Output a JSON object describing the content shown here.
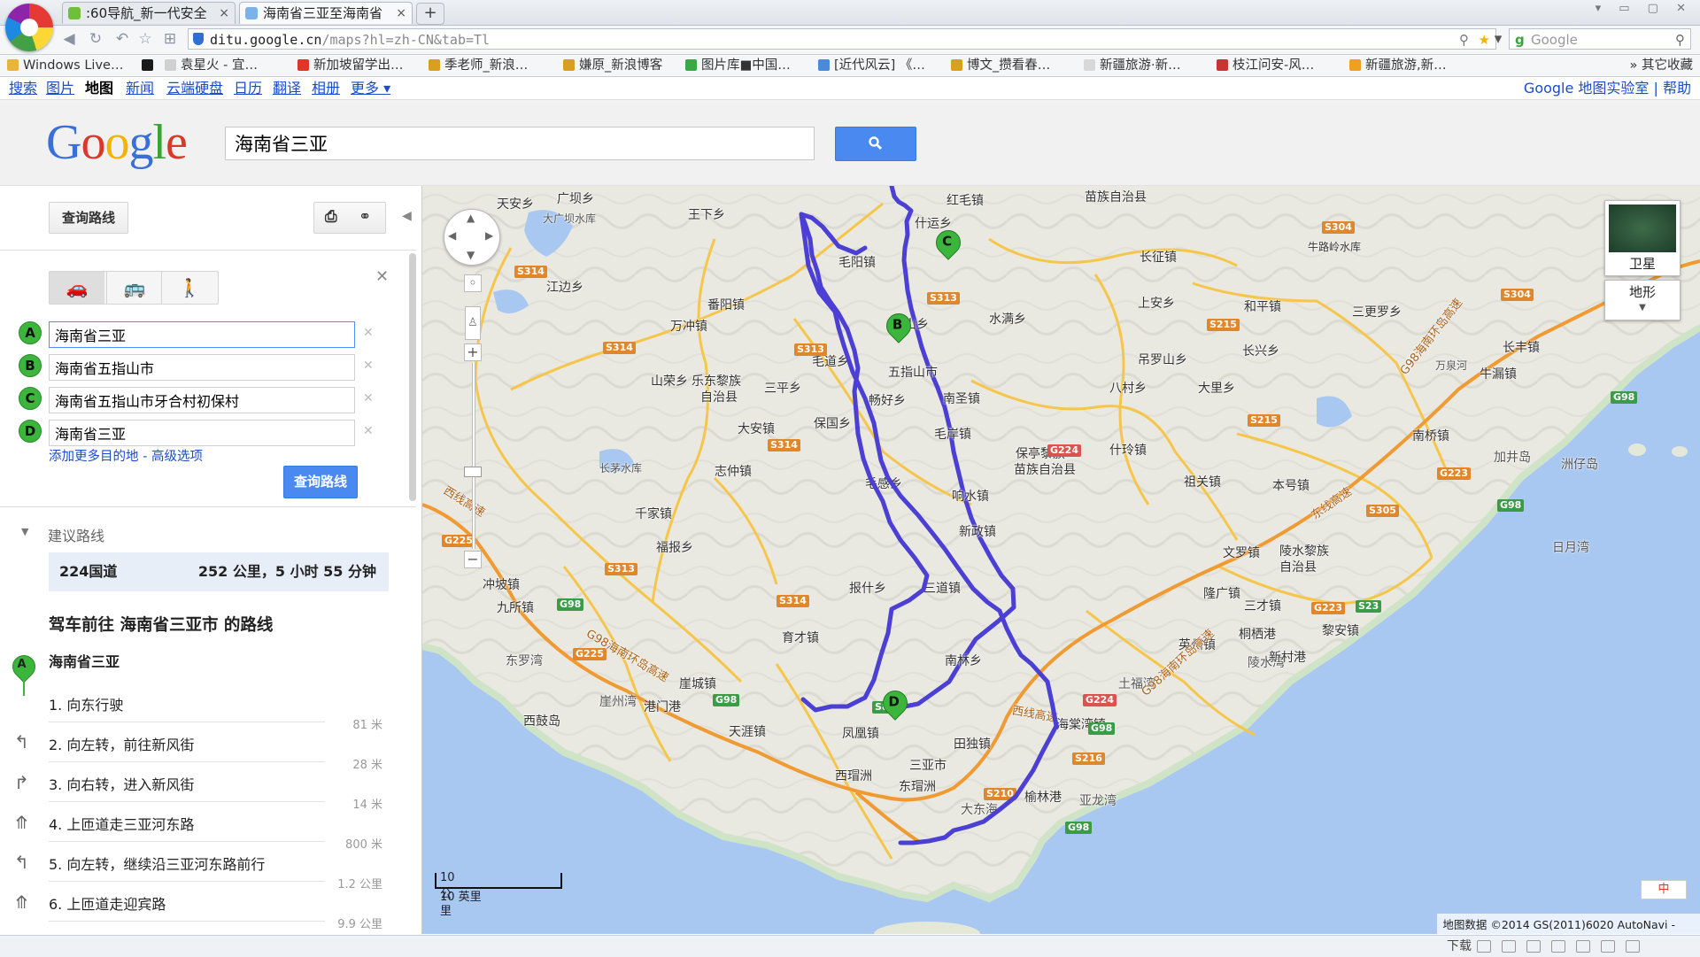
{
  "browser": {
    "tabs": [
      {
        "title": ":60导航_新一代安全",
        "active": false
      },
      {
        "title": "海南省三亚至海南省",
        "active": true
      }
    ],
    "new_tab": "+",
    "url_host": "ditu.google.cn",
    "url_path": "/maps?hl=zh-CN&tab=Tl",
    "search_placeholder": "Google",
    "status_download": "下载"
  },
  "bookmarks": [
    {
      "label": "Windows Live…",
      "color": "#f0c24a"
    },
    {
      "label": "",
      "color": "#1a1a1a"
    },
    {
      "label": "袁星火 - 宜…",
      "color": "#e0e0e0"
    },
    {
      "label": "新加坡留学出…",
      "color": "#e0352b"
    },
    {
      "label": "季老师_新浪…",
      "color": "#d9a020"
    },
    {
      "label": "嫌原_新浪博客",
      "color": "#d9a020"
    },
    {
      "label": "图片库■中国…",
      "color": "#39a845"
    },
    {
      "label": "[近代风云] 《…",
      "color": "#4a8ad8"
    },
    {
      "label": "博文_攒看春…",
      "color": "#d9a020"
    },
    {
      "label": "新疆旅游·新…",
      "color": "#e0e0e0"
    },
    {
      "label": "枝江问安-风…",
      "color": "#cc3333"
    },
    {
      "label": "新疆旅游,新…",
      "color": "#f0a020"
    }
  ],
  "bookmarks_more": "其它收藏",
  "gbar": {
    "links": [
      "搜索",
      "图片",
      "地图",
      "新闻",
      "云端硬盘",
      "日历",
      "翻译",
      "相册",
      "更多 ▾"
    ],
    "active": "地图",
    "right": "Google 地图实验室 | 帮助"
  },
  "search": {
    "logo": "Google",
    "query": "海南省三亚"
  },
  "panel": {
    "get_directions": "查询路线",
    "destinations": [
      {
        "letter": "A",
        "value": "海南省三亚"
      },
      {
        "letter": "B",
        "value": "海南省五指山市"
      },
      {
        "letter": "C",
        "value": "海南省五指山市牙合村初保村"
      },
      {
        "letter": "D",
        "value": "海南省三亚"
      }
    ],
    "add_more": "添加更多目的地 - 高级选项",
    "route_button": "查询路线",
    "suggested_title": "建议路线",
    "suggested_road": "224国道",
    "suggested_distance": "252 公里，5 小时 55 分钟",
    "directions_heading": "驾车前往 海南省三亚市 的路线",
    "start_name": "海南省三亚",
    "start_letter": "A",
    "steps": [
      {
        "text": "1. 向东行驶",
        "distance": "81 米",
        "icon": "straight-icon"
      },
      {
        "text": "2. 向左转，前往新风街",
        "distance": "28 米",
        "icon": "turn-left-icon"
      },
      {
        "text": "3. 向右转，进入新风街",
        "distance": "14 米",
        "icon": "turn-right-icon"
      },
      {
        "text": "4. 上匝道走三亚河东路",
        "distance": "800 米",
        "icon": "ramp-icon"
      },
      {
        "text": "5. 向左转，继续沿三亚河东路前行",
        "distance": "1.2 公里",
        "icon": "turn-left-icon"
      },
      {
        "text": "6. 上匝道走迎宾路",
        "distance": "9.9 公里",
        "icon": "ramp-icon"
      }
    ]
  },
  "map": {
    "satellite_label": "卫星",
    "terrain_label": "地形",
    "scale_km": "10 公里",
    "scale_mi": "10 英里",
    "attribution": "地图数据 ©2014 GS(2011)6020 AutoNavi -",
    "ime": "中",
    "route_markers": [
      "A",
      "B",
      "C",
      "D"
    ],
    "labels": [
      "天安乡",
      "广坝乡",
      "大广坝水库",
      "王下乡",
      "红毛镇",
      "苗族自治县",
      "什运乡",
      "江边乡",
      "番阳镇",
      "毛阳镇",
      "水满乡",
      "长征镇",
      "牛路岭水库",
      "和平镇",
      "上安乡",
      "三更罗乡",
      "万冲镇",
      "红山乡",
      "毛道乡",
      "五指山市",
      "吊罗山乡",
      "长兴乡",
      "长丰镇",
      "牛漏镇",
      "万泉河",
      "山荣乡",
      "乐东黎族",
      "自治县",
      "三平乡",
      "畅好乡",
      "南圣镇",
      "八村乡",
      "大里乡",
      "保国乡",
      "大安镇",
      "毛岸镇",
      "保亭黎族",
      "苗族自治县",
      "什玲镇",
      "南桥镇",
      "长茅水库",
      "志仲镇",
      "毛感乡",
      "响水镇",
      "祖关镇",
      "本号镇",
      "加井岛",
      "洲仔岛",
      "千家镇",
      "新政镇",
      "文罗镇",
      "陵水黎族",
      "自治县",
      "日月湾",
      "福报乡",
      "隆广镇",
      "冲坡镇",
      "报什乡",
      "三道镇",
      "三才镇",
      "九所镇",
      "桐栖港",
      "黎安镇",
      "育才镇",
      "英州镇",
      "陵水湾",
      "新村港",
      "东罗湾",
      "南林乡",
      "崖城镇",
      "土福湾",
      "崖州湾",
      "港门港",
      "海棠湾镇",
      "西鼓岛",
      "天涯镇",
      "凤凰镇",
      "田独镇",
      "西瑁洲",
      "东瑁洲",
      "三亚市",
      "榆林港",
      "亚龙湾",
      "大东海"
    ],
    "roads": [
      "S314",
      "S313",
      "S313",
      "S314",
      "S314",
      "S313",
      "S314",
      "S304",
      "S304",
      "S215",
      "S215",
      "G224",
      "G224",
      "G98",
      "G98",
      "G98",
      "G98",
      "G223",
      "G223",
      "S23",
      "S305",
      "S84",
      "S210",
      "S216",
      "G225",
      "G225",
      "G98",
      "G98"
    ],
    "road_names": [
      "西线高速",
      "G98海南环岛高速",
      "G98海南环岛高速",
      "东线高速",
      "西线高速",
      "G98海南环岛高速"
    ]
  }
}
